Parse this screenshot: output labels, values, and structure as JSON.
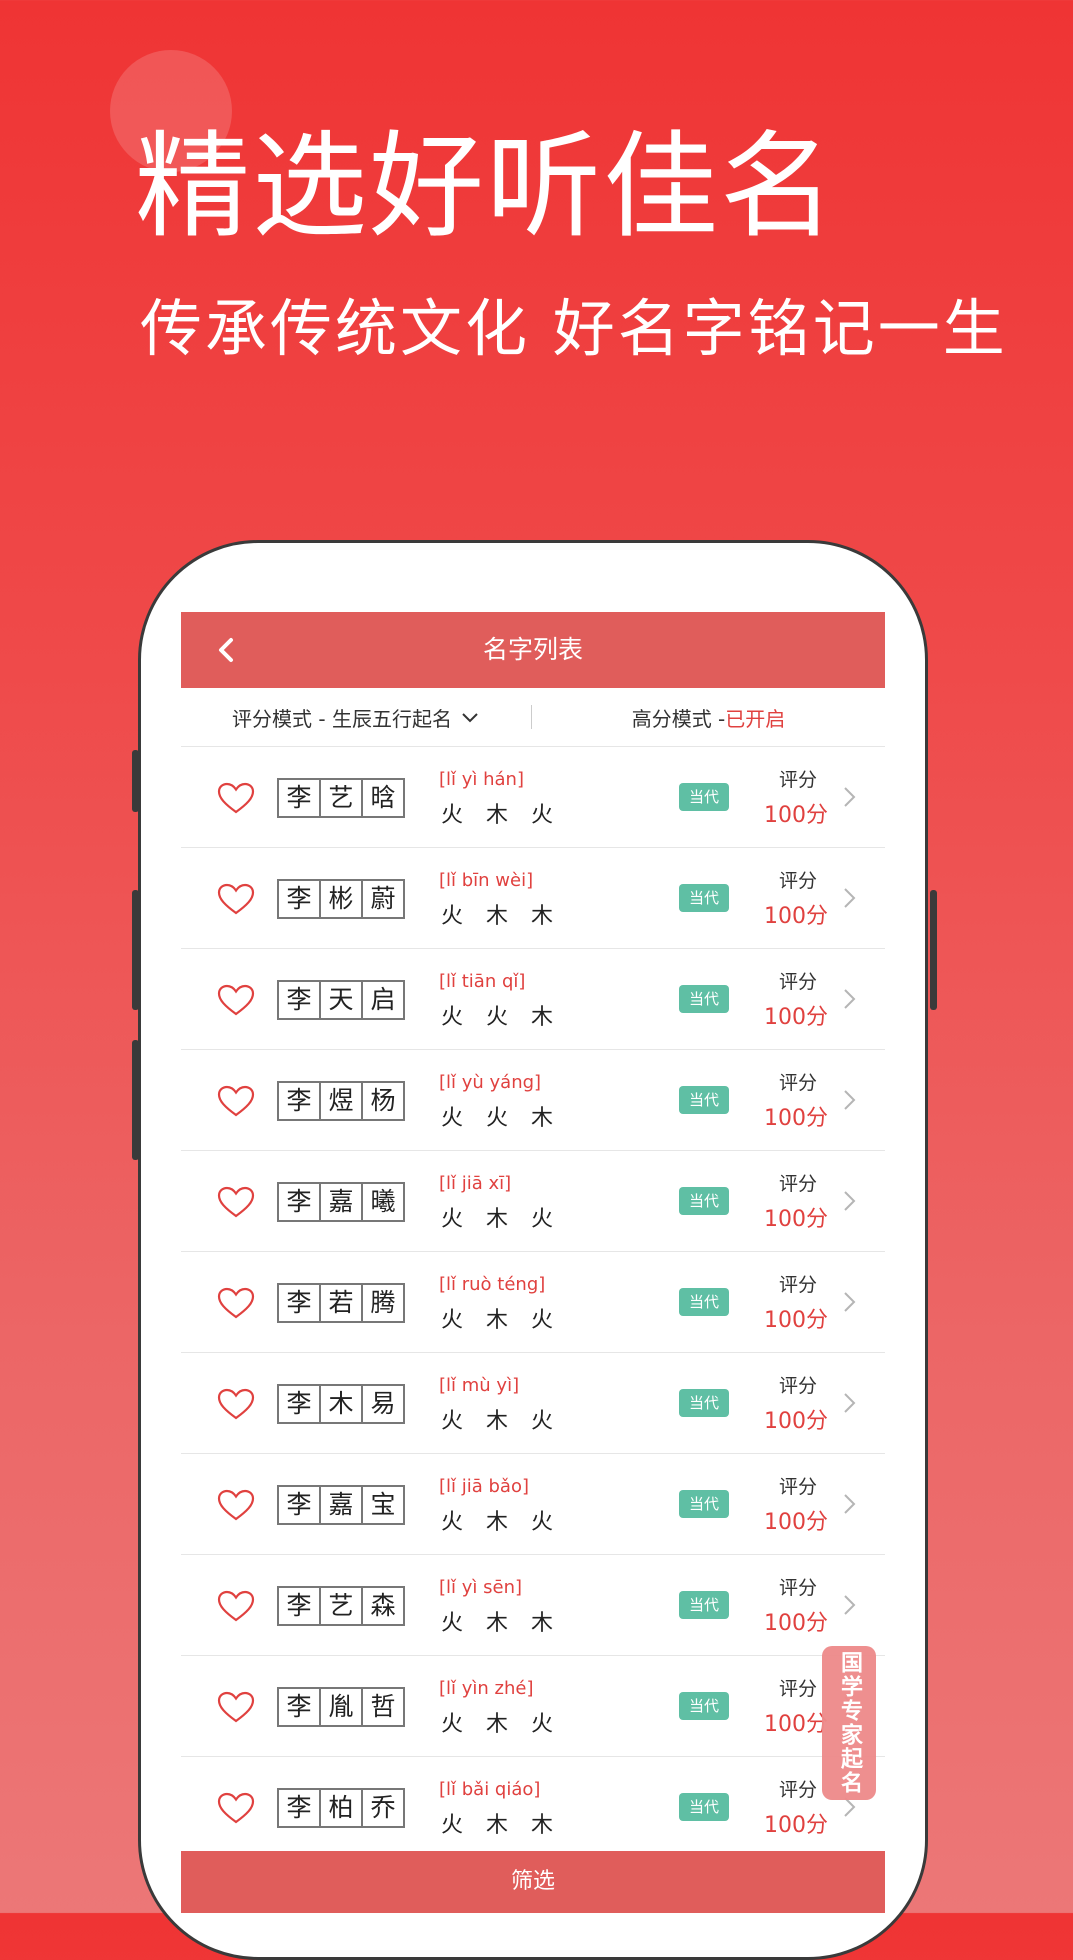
{
  "hero": {
    "title": "精选好听佳名",
    "subtitle": "传承传统文化 好名字铭记一生"
  },
  "topbar": {
    "back_icon": "chevron-left-icon",
    "title": "名字列表"
  },
  "modebar": {
    "mode_label": "评分模式 - 生辰五行起名",
    "high_score_label": "高分模式 - ",
    "high_score_status": "已开启"
  },
  "names": [
    {
      "chars": [
        "李",
        "艺",
        "晗"
      ],
      "pinyin": "[lǐ yì hán]",
      "wuxing": "火 木 火",
      "era": "当代",
      "score_label": "评分",
      "score": "100分"
    },
    {
      "chars": [
        "李",
        "彬",
        "蔚"
      ],
      "pinyin": "[lǐ bīn wèi]",
      "wuxing": "火 木 木",
      "era": "当代",
      "score_label": "评分",
      "score": "100分"
    },
    {
      "chars": [
        "李",
        "天",
        "启"
      ],
      "pinyin": "[lǐ tiān qǐ]",
      "wuxing": "火 火 木",
      "era": "当代",
      "score_label": "评分",
      "score": "100分"
    },
    {
      "chars": [
        "李",
        "煜",
        "杨"
      ],
      "pinyin": "[lǐ yù yáng]",
      "wuxing": "火 火 木",
      "era": "当代",
      "score_label": "评分",
      "score": "100分"
    },
    {
      "chars": [
        "李",
        "嘉",
        "曦"
      ],
      "pinyin": "[lǐ jiā xī]",
      "wuxing": "火 木 火",
      "era": "当代",
      "score_label": "评分",
      "score": "100分"
    },
    {
      "chars": [
        "李",
        "若",
        "腾"
      ],
      "pinyin": "[lǐ ruò téng]",
      "wuxing": "火 木 火",
      "era": "当代",
      "score_label": "评分",
      "score": "100分"
    },
    {
      "chars": [
        "李",
        "木",
        "易"
      ],
      "pinyin": "[lǐ mù yì]",
      "wuxing": "火 木 火",
      "era": "当代",
      "score_label": "评分",
      "score": "100分"
    },
    {
      "chars": [
        "李",
        "嘉",
        "宝"
      ],
      "pinyin": "[lǐ jiā bǎo]",
      "wuxing": "火 木 火",
      "era": "当代",
      "score_label": "评分",
      "score": "100分"
    },
    {
      "chars": [
        "李",
        "艺",
        "森"
      ],
      "pinyin": "[lǐ yì sēn]",
      "wuxing": "火 木 木",
      "era": "当代",
      "score_label": "评分",
      "score": "100分"
    },
    {
      "chars": [
        "李",
        "胤",
        "哲"
      ],
      "pinyin": "[lǐ yìn zhé]",
      "wuxing": "火 木 火",
      "era": "当代",
      "score_label": "评分",
      "score": "100分"
    },
    {
      "chars": [
        "李",
        "柏",
        "乔"
      ],
      "pinyin": "[lǐ bǎi qiáo]",
      "wuxing": "火 木 木",
      "era": "当代",
      "score_label": "评分",
      "score": "100分"
    }
  ],
  "filter_button": "筛选",
  "expert_badge": "国学专家起名",
  "colors": {
    "accent": "#e05d5b",
    "highlight_text": "#e0413f",
    "badge_green": "#5fbfa4"
  }
}
